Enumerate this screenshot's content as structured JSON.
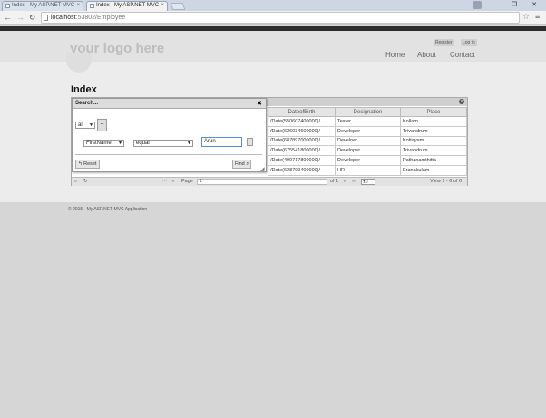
{
  "browser": {
    "tabs": [
      {
        "title": "Index - My ASP.NET MVC",
        "active": false
      },
      {
        "title": "Index - My ASP.NET MVC",
        "active": true
      }
    ],
    "window_controls": {
      "minimize": "–",
      "restore": "❐",
      "close": "✕"
    },
    "url": {
      "host": "localhost",
      "path": ":53802/Employee"
    },
    "nav": {
      "back": "←",
      "forward": "→",
      "reload": "↻"
    },
    "star": "☆",
    "menu": "≡"
  },
  "site": {
    "logo": "your logo here",
    "login_links": [
      "Register",
      "Log in"
    ],
    "nav_items": [
      "Home",
      "About",
      "Contact"
    ],
    "page_title": "Index",
    "footer": "© 2015 - My ASP.NET MVC Application"
  },
  "grid": {
    "columns": [
      "DateofBirth",
      "Designation",
      "Place"
    ],
    "rows": [
      [
        "/Date(550607400000)/",
        "Tester",
        "Kollam"
      ],
      [
        "/Date(626034600000)/",
        "Developer",
        "Trivandrum"
      ],
      [
        "/Date(687897000000)/",
        "Develoer",
        "Kottayam"
      ],
      [
        "/Date(675541800000)/",
        "Developer",
        "Trivandrum"
      ],
      [
        "/Date(499717800000)/",
        "Developer",
        "Pathanamthitta"
      ],
      [
        "/Date(628799400000)/",
        "HR",
        "Eranakulam"
      ]
    ],
    "pager": {
      "page_label": "Page",
      "page_value": "1",
      "of_label": "of 1",
      "rows_per_page": "10",
      "view_text": "View 1 - 6 of 6",
      "first": "⏮",
      "prev": "◂",
      "next": "▸",
      "last": "⏭"
    }
  },
  "search_dialog": {
    "title": "Search...",
    "close": "✖",
    "group_op": "all",
    "add_rule": "+",
    "field": "FirstName",
    "operator": "equal",
    "value": "Arun",
    "remove_rule": "-",
    "reset_label": "↰ Reset",
    "find_label": "Find ⌕"
  }
}
